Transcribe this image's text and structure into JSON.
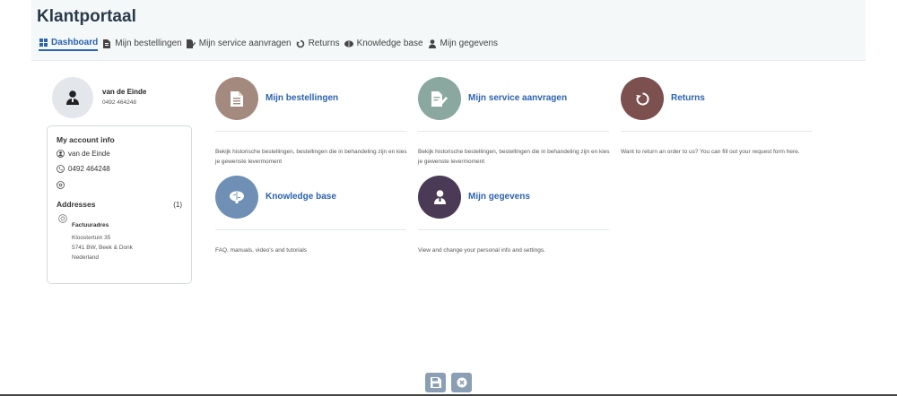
{
  "app": {
    "title": "Klantportaal"
  },
  "nav": [
    {
      "label": "Dashboard",
      "icon": "grid-icon",
      "active": true
    },
    {
      "label": "Mijn bestellingen",
      "icon": "document-icon"
    },
    {
      "label": "Mijn service aanvragen",
      "icon": "edit-document-icon"
    },
    {
      "label": "Returns",
      "icon": "return-icon"
    },
    {
      "label": "Knowledge base",
      "icon": "brain-icon"
    },
    {
      "label": "Mijn gegevens",
      "icon": "user-icon"
    }
  ],
  "profile": {
    "name": "van de Einde",
    "phone": "0492 464248",
    "icon": "user-icon"
  },
  "account": {
    "title": "My account info",
    "name": "van de Einde",
    "phone": "0492 464248",
    "email": "",
    "addresses_title": "Addresses",
    "addresses_count": "(1)",
    "address": {
      "name": "Factuuradres",
      "lines": [
        "Kloostertuin 35",
        "5741 BW, Beek & Donk",
        "Nederland"
      ]
    }
  },
  "tiles": [
    {
      "title": "Mijn bestellingen",
      "description": "Bekijk historische bestellingen, bestellingen die in behandeling zijn en kies je gewenste levermoment",
      "color": "#a48a7e",
      "icon": "document-icon"
    },
    {
      "title": "Mijn service aanvragen",
      "description": "Bekijk historische bestellingen, bestellingen die in behandeling zijn en kies je gewenste levermoment",
      "color": "#8aa89f",
      "icon": "edit-document-icon"
    },
    {
      "title": "Returns",
      "description": "Want to return an order to us? You can fill out your request form here.",
      "color": "#7d5050",
      "icon": "return-icon"
    },
    {
      "title": "Knowledge base",
      "description": "FAQ, manuals, video's and tutorials",
      "color": "#6f8fb5",
      "icon": "brain-icon"
    },
    {
      "title": "Mijn gegevens",
      "description": "View and change your personal info and settings.",
      "color": "#4a3a55",
      "icon": "user-icon"
    }
  ],
  "footer": {
    "buttons": [
      "save-icon",
      "close-icon"
    ]
  },
  "colors": {
    "accent": "#2b62b2",
    "title": "#2b3a4a",
    "footer_button": "#8a9fb3"
  }
}
